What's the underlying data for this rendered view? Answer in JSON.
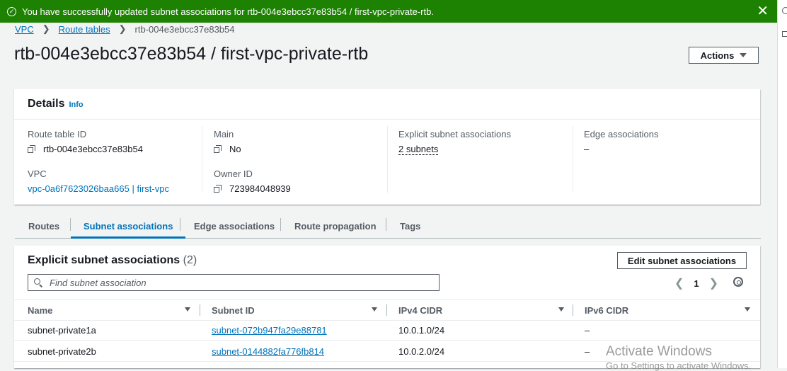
{
  "flash": {
    "message": "You have successfully updated subnet associations for rtb-004e3ebcc37e83b54 / first-vpc-private-rtb.",
    "close_glyph": "✕"
  },
  "breadcrumb": {
    "items": [
      "VPC",
      "Route tables"
    ],
    "current": "rtb-004e3ebcc37e83b54"
  },
  "page": {
    "title": "rtb-004e3ebcc37e83b54 / first-vpc-private-rtb",
    "actions_label": "Actions"
  },
  "details": {
    "header": "Details",
    "info": "Info",
    "route_table_id_label": "Route table ID",
    "route_table_id": "rtb-004e3ebcc37e83b54",
    "vpc_label": "VPC",
    "vpc_value": "vpc-0a6f7623026baa665 | first-vpc",
    "main_label": "Main",
    "main_value": "No",
    "owner_label": "Owner ID",
    "owner_value": "723984048939",
    "explicit_label": "Explicit subnet associations",
    "explicit_value": "2 subnets",
    "edge_label": "Edge associations",
    "edge_value": "–"
  },
  "tabs": [
    "Routes",
    "Subnet associations",
    "Edge associations",
    "Route propagation",
    "Tags"
  ],
  "subnets": {
    "title": "Explicit subnet associations",
    "count": "(2)",
    "edit_label": "Edit subnet associations",
    "search_placeholder": "Find subnet association",
    "page_number": "1",
    "columns": [
      "Name",
      "Subnet ID",
      "IPv4 CIDR",
      "IPv6 CIDR"
    ],
    "rows": [
      {
        "name": "subnet-private1a",
        "subnet_id": "subnet-072b947fa29e88781",
        "ipv4": "10.0.1.0/24",
        "ipv6": "–"
      },
      {
        "name": "subnet-private2b",
        "subnet_id": "subnet-0144882fa776fb814",
        "ipv4": "10.0.2.0/24",
        "ipv6": "–"
      }
    ]
  },
  "watermark": {
    "line1": "Activate Windows",
    "line2": "Go to Settings to activate Windows."
  }
}
